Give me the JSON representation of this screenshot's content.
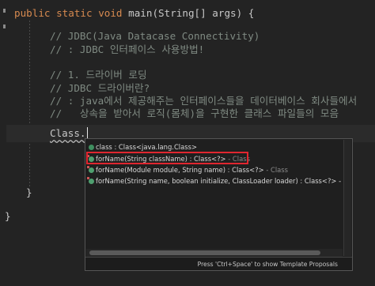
{
  "code": {
    "line_signature": {
      "kw1": "public",
      "kw2": "static",
      "kw3": "void",
      "rest": "main(String[] args) {"
    },
    "comment1": "// JDBC(Java Datacase Connectivity)",
    "comment2": "// : JDBC 인터페이스 사용방법!",
    "comment3": "// 1. 드라이버 로딩",
    "comment4": "// JDBC 드라이버란?",
    "comment5": "// : java에서 제공해주는 인터페이스들을 데이터베이스 회사들에서",
    "comment6": "//   상속을 받아서 로직(몸체)을 구현한 클래스 파일들의 모음",
    "typed": "Class.",
    "close_brace_inner": "}",
    "close_brace_outer": "}"
  },
  "autocomplete": {
    "items": [
      {
        "icon": "field-icon",
        "main": "class : Class<java.lang.Class>",
        "type": ""
      },
      {
        "icon": "static-method-icon",
        "main": "forName(String className) : Class<?>",
        "type": " - Class"
      },
      {
        "icon": "static-method-icon",
        "main": "forName(Module module, String name) : Class<?>",
        "type": " - Class"
      },
      {
        "icon": "static-method-icon",
        "main": "forName(String name, boolean initialize, ClassLoader loader) : Class<?> - C",
        "type": ""
      }
    ],
    "footer": "Press 'Ctrl+Space' to show Template Proposals"
  }
}
